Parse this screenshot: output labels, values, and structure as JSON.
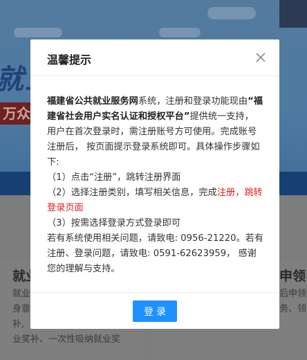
{
  "background": {
    "banner_title": "就业",
    "banner_badge": "万众",
    "left_card": {
      "title": "就业",
      "lines": [
        "就业",
        "身意",
        "补,",
        "业奖补、一次性吸纳就业奖"
      ]
    },
    "right_card": {
      "title": "申领",
      "lines": [
        "后申领",
        "务、领"
      ]
    }
  },
  "modal": {
    "title": "温馨提示",
    "body": {
      "p1_bold": "福建省公共就业服务网",
      "p1_text": "系统，注册和登录功能现由",
      "p1_bold2": "“福建省社会用户实名认证和授权平台”",
      "p1_text2": "提供统一支持， 用户在首次登录时，需注册账号方可使用。完成账号注册后， 按页面提示登录系统即可。具体操作步骤如下:",
      "step1": "（1）点击“注册”，跳转注册界面",
      "step2_text": "（2）选择注册类别，填写相关信息，完成",
      "step2_red": "注册，跳转登录页面",
      "step3": "（3）按需选择登录方式登录即可",
      "contact": "若有系统使用相关问题，请致电: 0956-21220。若有注册、登录问题，请致电: 0591-62623959， 感谢您的理解与支持。"
    },
    "login_label": "登录"
  },
  "colors": {
    "primary": "#1e90ff",
    "highlight_red": "#e02020",
    "overlay": "#7c7c7c"
  }
}
